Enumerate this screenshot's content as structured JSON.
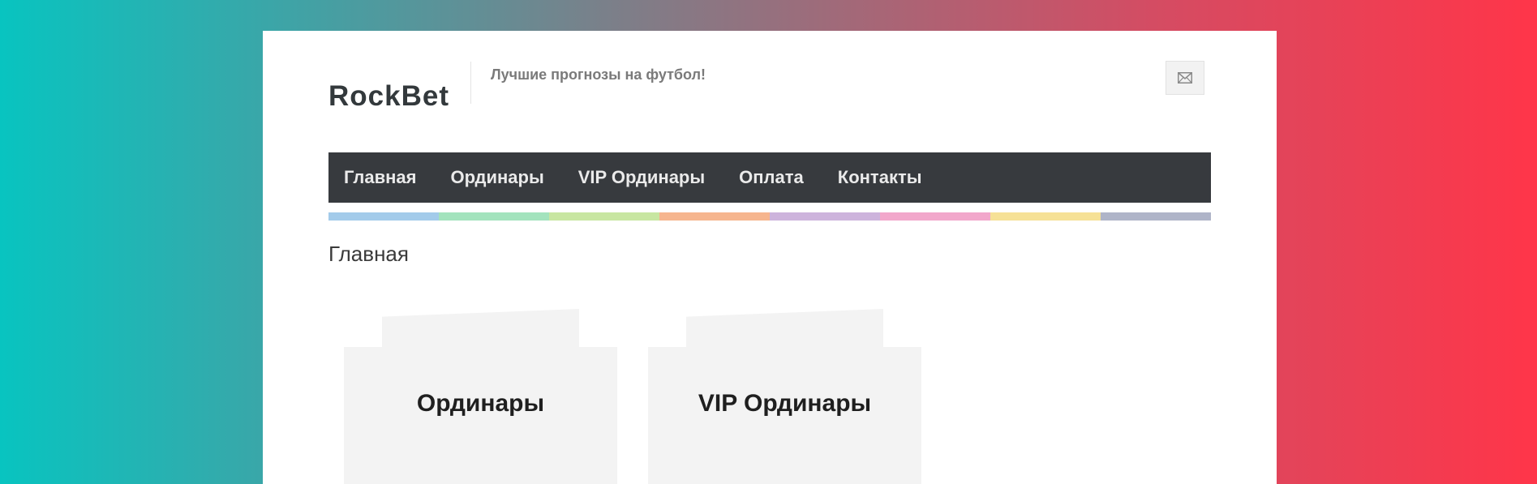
{
  "site": {
    "logo": "RockBet",
    "tagline": "Лучшие прогнозы на футбол!"
  },
  "header": {
    "mail_icon": "envelope-icon"
  },
  "nav": {
    "items": [
      {
        "label": "Главная"
      },
      {
        "label": "Ординары"
      },
      {
        "label": "VIP Ординары"
      },
      {
        "label": "Оплата"
      },
      {
        "label": "Контакты"
      }
    ]
  },
  "stripe": {
    "colors": [
      "#a3cbea",
      "#a3e3bd",
      "#c8e6a1",
      "#f6b58e",
      "#cdb3dc",
      "#f2a7cb",
      "#f6e196",
      "#afb4c8"
    ]
  },
  "breadcrumb": {
    "current": "Главная"
  },
  "cards": [
    {
      "title": "Ординары"
    },
    {
      "title": "VIP Ординары"
    }
  ],
  "colors": {
    "nav_bg": "#373a3e",
    "card_bg": "#f3f3f3",
    "page_bg": "#ffffff"
  }
}
